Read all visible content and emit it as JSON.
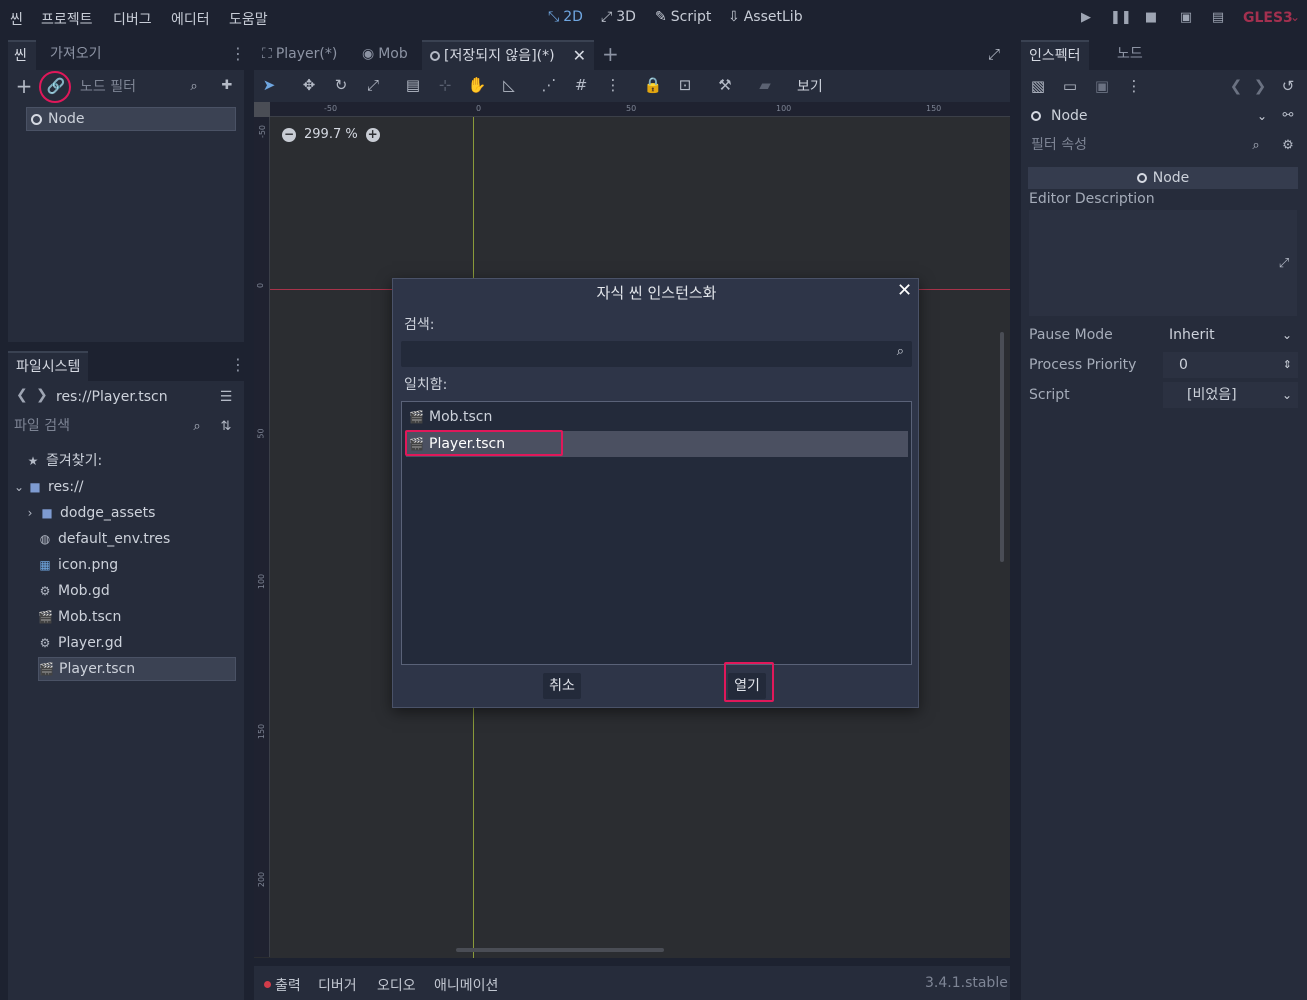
{
  "menubar": {
    "menus": [
      "씬",
      "프로젝트",
      "디버그",
      "에디터",
      "도움말"
    ],
    "workspaces": [
      {
        "label": "2D",
        "icon": "2d-workspace-icon"
      },
      {
        "label": "3D",
        "icon": "3d-workspace-icon"
      },
      {
        "label": "Script",
        "icon": "script-workspace-icon"
      },
      {
        "label": "AssetLib",
        "icon": "assetlib-workspace-icon"
      }
    ],
    "renderer": "GLES3",
    "accent_color": "#6fa6e0",
    "renderer_color": "#a3304f"
  },
  "scene_dock": {
    "tabs": [
      "씬",
      "가져오기"
    ],
    "filter_placeholder": "노드 필터",
    "root_node": "Node"
  },
  "filesystem_dock": {
    "title": "파일시스템",
    "path": "res://Player.tscn",
    "search_placeholder": "파일 검색",
    "favorites": "즐겨찾기:",
    "root": "res://",
    "items": [
      {
        "label": "dodge_assets",
        "icon": "folder-icon"
      },
      {
        "label": "default_env.tres",
        "icon": "environment-icon"
      },
      {
        "label": "icon.png",
        "icon": "image-icon"
      },
      {
        "label": "Mob.gd",
        "icon": "gear-icon"
      },
      {
        "label": "Mob.tscn",
        "icon": "clapperboard-icon"
      },
      {
        "label": "Player.gd",
        "icon": "gear-icon"
      },
      {
        "label": "Player.tscn",
        "icon": "clapperboard-icon",
        "selected": true
      }
    ]
  },
  "editor": {
    "tabs": [
      "Player(*)",
      "Mob",
      "[저장되지 않음](*)"
    ],
    "view_menu": "보기",
    "zoom": "299.7 %",
    "ruler_h": [
      "-50",
      "0",
      "50",
      "100",
      "150"
    ],
    "ruler_v": [
      "-50",
      "0",
      "50",
      "100",
      "150",
      "200"
    ]
  },
  "dialog": {
    "title": "자식 씬 인스턴스화",
    "search_label": "검색:",
    "search_value": "",
    "matches_label": "일치함:",
    "items": [
      {
        "label": "Mob.tscn",
        "icon": "clapperboard-icon"
      },
      {
        "label": "Player.tscn",
        "icon": "clapperboard-icon",
        "selected": true
      }
    ],
    "cancel_label": "취소",
    "open_label": "열기",
    "highlight_color": "#e0185a"
  },
  "inspector": {
    "tabs": [
      "인스펙터",
      "노드"
    ],
    "node_select": "Node",
    "filter_placeholder": "필터 속성",
    "section": "Node",
    "editor_description_label": "Editor Description",
    "properties": [
      {
        "label": "Pause Mode",
        "value": "Inherit"
      },
      {
        "label": "Process Priority",
        "value": "0"
      },
      {
        "label": "Script",
        "value": "[비었음]"
      }
    ]
  },
  "bottom_panel": {
    "tabs": [
      "출력",
      "디버거",
      "오디오",
      "애니메이션"
    ],
    "version": "3.4.1.stable"
  }
}
